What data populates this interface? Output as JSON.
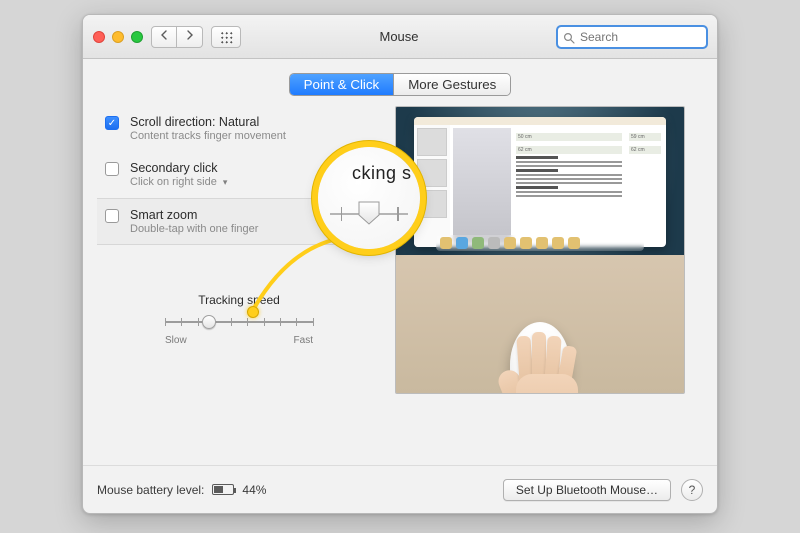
{
  "window": {
    "title": "Mouse"
  },
  "search": {
    "placeholder": "Search"
  },
  "tabs": {
    "point_click": "Point & Click",
    "more_gestures": "More Gestures"
  },
  "options": {
    "scroll": {
      "title": "Scroll direction: Natural",
      "desc": "Content tracks finger movement",
      "checked": true
    },
    "secondary": {
      "title": "Secondary click",
      "desc": "Click on right side",
      "checked": false
    },
    "zoom": {
      "title": "Smart zoom",
      "desc": "Double-tap with one finger",
      "checked": false
    }
  },
  "tracking": {
    "title": "Tracking speed",
    "slow": "Slow",
    "fast": "Fast",
    "value": 3,
    "max": 10
  },
  "bottom": {
    "battery_label": "Mouse battery level:",
    "battery_value": "44%",
    "bluetooth": "Set Up Bluetooth Mouse…",
    "help": "?"
  },
  "callout": {
    "mag_text": "cking s"
  }
}
